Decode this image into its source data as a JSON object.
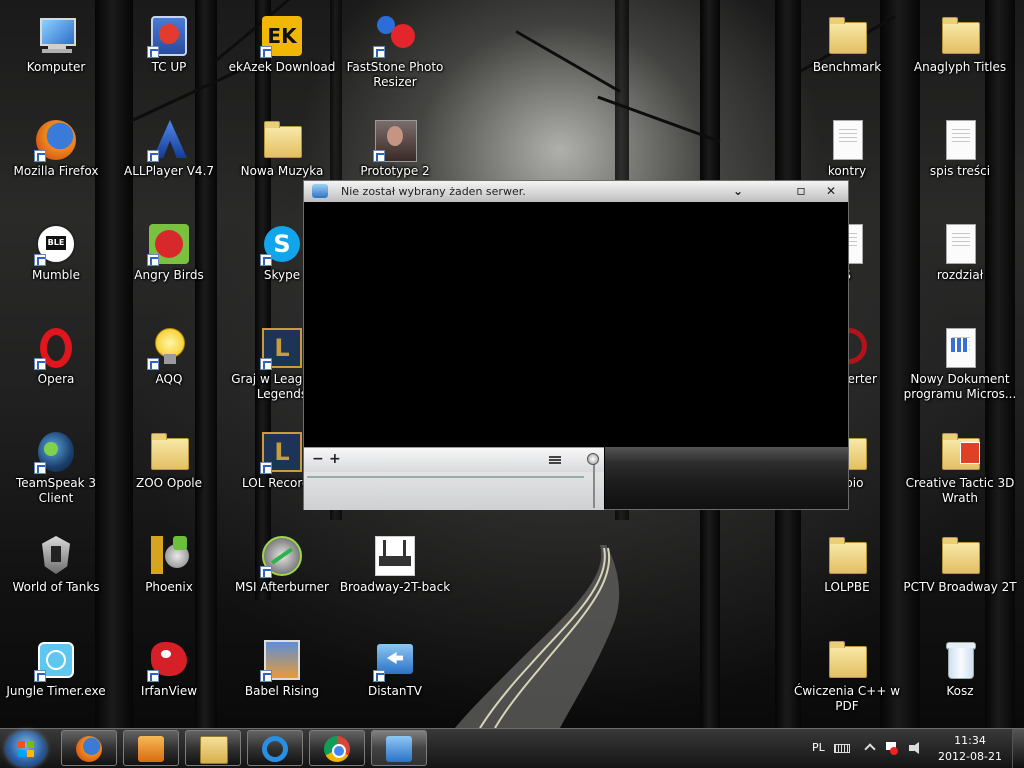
{
  "desktop": {
    "icons": [
      {
        "label": "Komputer"
      },
      {
        "label": "TC UP"
      },
      {
        "label": "ekAzek Download"
      },
      {
        "label": "FastStone Photo Resizer"
      },
      {
        "label": "Benchmark"
      },
      {
        "label": "Anaglyph Titles"
      },
      {
        "label": "Mozilla Firefox"
      },
      {
        "label": "ALLPlayer V4.7"
      },
      {
        "label": "Nowa Muzyka"
      },
      {
        "label": "Prototype 2"
      },
      {
        "label": "kontry"
      },
      {
        "label": "spis treści"
      },
      {
        "label": "Mumble"
      },
      {
        "label": "Angry Birds"
      },
      {
        "label": "Skype"
      },
      {
        "label": "S"
      },
      {
        "label": "rozdział"
      },
      {
        "label": "Opera"
      },
      {
        "label": "AQQ"
      },
      {
        "label": "Graj w League of Legends"
      },
      {
        "label": "Converter"
      },
      {
        "label": "Nowy Dokument programu Micros..."
      },
      {
        "label": "TeamSpeak 3 Client"
      },
      {
        "label": "ZOO Opole"
      },
      {
        "label": "LOL Recorder"
      },
      {
        "label": "Kopio"
      },
      {
        "label": "Creative Tactic 3D Wrath"
      },
      {
        "label": "World of Tanks"
      },
      {
        "label": "Phoenix"
      },
      {
        "label": "MSI Afterburner"
      },
      {
        "label": "Broadway-2T-back"
      },
      {
        "label": "LOLPBE"
      },
      {
        "label": "PCTV Broadway 2T"
      },
      {
        "label": "Jungle Timer.exe"
      },
      {
        "label": "IrfanView"
      },
      {
        "label": "Babel Rising"
      },
      {
        "label": "DistanTV"
      },
      {
        "label": "Ćwiczenia C++ w PDF"
      },
      {
        "label": "Kosz"
      }
    ]
  },
  "window": {
    "title": "Nie został wybrany żaden serwer.",
    "minimize": "⌄",
    "maximize": "▫",
    "close": "✕",
    "panel_minus": "−",
    "panel_plus": "+"
  },
  "taskbar": {
    "pinned": [
      "firefox-icon",
      "media-player-icon",
      "explorer-icon",
      "internet-explorer-icon",
      "chrome-icon",
      "distantv-icon"
    ],
    "language": "PL",
    "time": "11:34",
    "date": "2012-08-21"
  }
}
